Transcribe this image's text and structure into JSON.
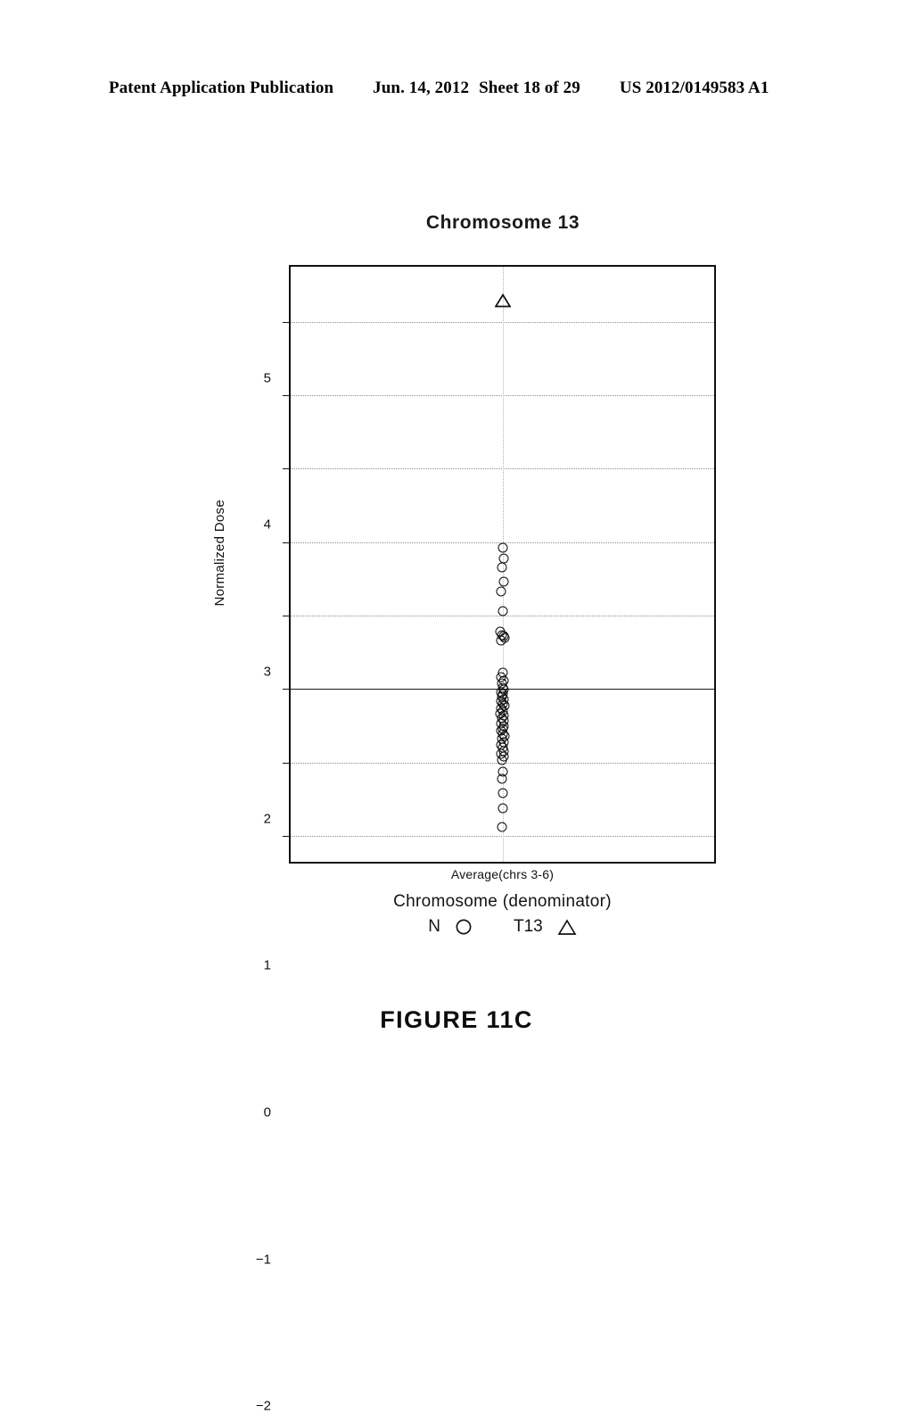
{
  "header": {
    "publication": "Patent Application Publication",
    "date": "Jun. 14, 2012",
    "sheet": "Sheet 18 of 29",
    "number": "US 2012/0149583 A1"
  },
  "figure": {
    "caption": "FIGURE 11C"
  },
  "chart_data": {
    "type": "scatter",
    "title": "Chromosome 13",
    "xlabel": "Chromosome (denominator)",
    "ylabel": "Normalized Dose",
    "x_tick_labels": [
      "Average(chrs 3-6)"
    ],
    "y_ticks": [
      5,
      4,
      3,
      2,
      1,
      0,
      -1,
      -2
    ],
    "ylim": [
      -2.35,
      5.75
    ],
    "grid": "horizontal-dotted",
    "zero_line": true,
    "legend_position": "below-axis",
    "legend": [
      {
        "name": "N",
        "marker": "circle-open"
      },
      {
        "name": "T13",
        "marker": "triangle-open"
      }
    ],
    "series": [
      {
        "name": "N",
        "marker": "circle-open",
        "x_category": "Average(chrs 3-6)",
        "values": [
          1.92,
          1.78,
          1.66,
          1.46,
          1.33,
          1.06,
          0.78,
          0.74,
          0.72,
          0.7,
          0.66,
          0.22,
          0.16,
          0.12,
          0.08,
          0.02,
          -0.01,
          -0.04,
          -0.07,
          -0.1,
          -0.14,
          -0.17,
          -0.2,
          -0.23,
          -0.26,
          -0.3,
          -0.33,
          -0.36,
          -0.4,
          -0.43,
          -0.47,
          -0.5,
          -0.54,
          -0.57,
          -0.61,
          -0.64,
          -0.68,
          -0.72,
          -0.76,
          -0.8,
          -0.84,
          -0.88,
          -0.92,
          -0.96,
          -1.12,
          -1.22,
          -1.42,
          -1.62,
          -1.88
        ],
        "jitter": [
          0.0,
          0.06,
          -0.02,
          0.04,
          -0.04,
          0.0,
          -0.1,
          -0.03,
          0.04,
          0.1,
          -0.06,
          0.02,
          -0.05,
          0.06,
          -0.01,
          0.0,
          0.07,
          -0.06,
          0.03,
          -0.03,
          0.05,
          -0.07,
          0.01,
          0.08,
          -0.04,
          0.02,
          -0.08,
          0.06,
          -0.02,
          0.04,
          -0.05,
          0.07,
          0.0,
          -0.06,
          0.03,
          0.08,
          -0.03,
          0.05,
          -0.07,
          0.01,
          0.04,
          -0.04,
          0.06,
          -0.01,
          0.02,
          -0.02,
          0.0,
          0.01,
          -0.01
        ]
      },
      {
        "name": "T13",
        "marker": "triangle-open",
        "x_category": "Average(chrs 3-6)",
        "values": [
          5.29
        ],
        "jitter": [
          0.0
        ]
      }
    ]
  }
}
